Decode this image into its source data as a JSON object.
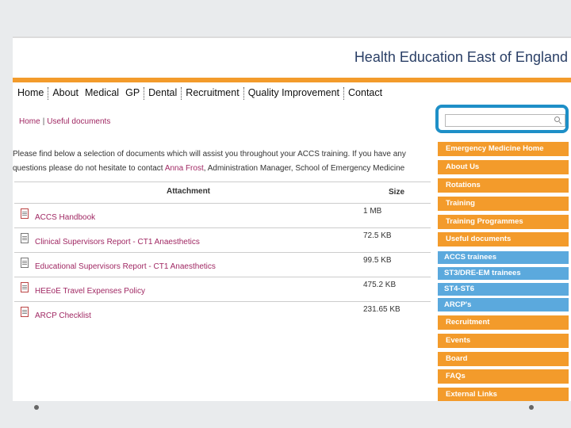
{
  "header": {
    "title": "Health Education East of England"
  },
  "nav": [
    "Home",
    "About",
    "Medical",
    "GP",
    "Dental",
    "Recruitment",
    "Quality Improvement",
    "Contact"
  ],
  "breadcrumb": {
    "home": "Home",
    "separator": "|",
    "current": "Useful documents"
  },
  "intro": {
    "text_before": "Please find below a selection of documents which will assist you throughout your ACCS training. If you have any questions please do not hesitate to contact ",
    "contact_name": "Anna Frost",
    "text_after": ", Administration Manager, School of Emergency Medicine"
  },
  "table": {
    "headers": {
      "attachment": "Attachment",
      "size": "Size"
    },
    "rows": [
      {
        "name": "ACCS Handbook",
        "size": "1 MB"
      },
      {
        "name": "Clinical Supervisors Report - CT1 Anaesthetics",
        "size": "72.5 KB"
      },
      {
        "name": "Educational Supervisors Report - CT1 Anaesthetics",
        "size": "99.5 KB"
      },
      {
        "name": "HEEoE Travel Expenses Policy",
        "size": "475.2 KB"
      },
      {
        "name": "ARCP Checklist",
        "size": "231.65 KB"
      }
    ]
  },
  "search": {
    "placeholder": ""
  },
  "sidebar": {
    "items": [
      {
        "label": "Emergency Medicine Home",
        "style": "orange"
      },
      {
        "label": "About Us",
        "style": "orange"
      },
      {
        "label": "Rotations",
        "style": "orange"
      },
      {
        "label": "Training",
        "style": "orange"
      },
      {
        "label": "Training Programmes",
        "style": "orange"
      },
      {
        "label": "Useful documents",
        "style": "orange"
      },
      {
        "label": "ACCS trainees",
        "style": "blue"
      },
      {
        "label": "ST3/DRE-EM trainees",
        "style": "blue"
      },
      {
        "label": "ST4-ST6",
        "style": "blue"
      },
      {
        "label": "ARCP's",
        "style": "blue"
      },
      {
        "label": "Recruitment",
        "style": "orange"
      },
      {
        "label": "Events",
        "style": "orange"
      },
      {
        "label": "Board",
        "style": "orange"
      },
      {
        "label": "FAQs",
        "style": "orange"
      },
      {
        "label": "External Links",
        "style": "orange"
      }
    ]
  },
  "colors": {
    "accent_orange": "#f39b2b",
    "accent_blue": "#5ba9dd",
    "highlight_ring": "#1e8fc7",
    "link": "#a02863",
    "title": "#2a3f66"
  }
}
